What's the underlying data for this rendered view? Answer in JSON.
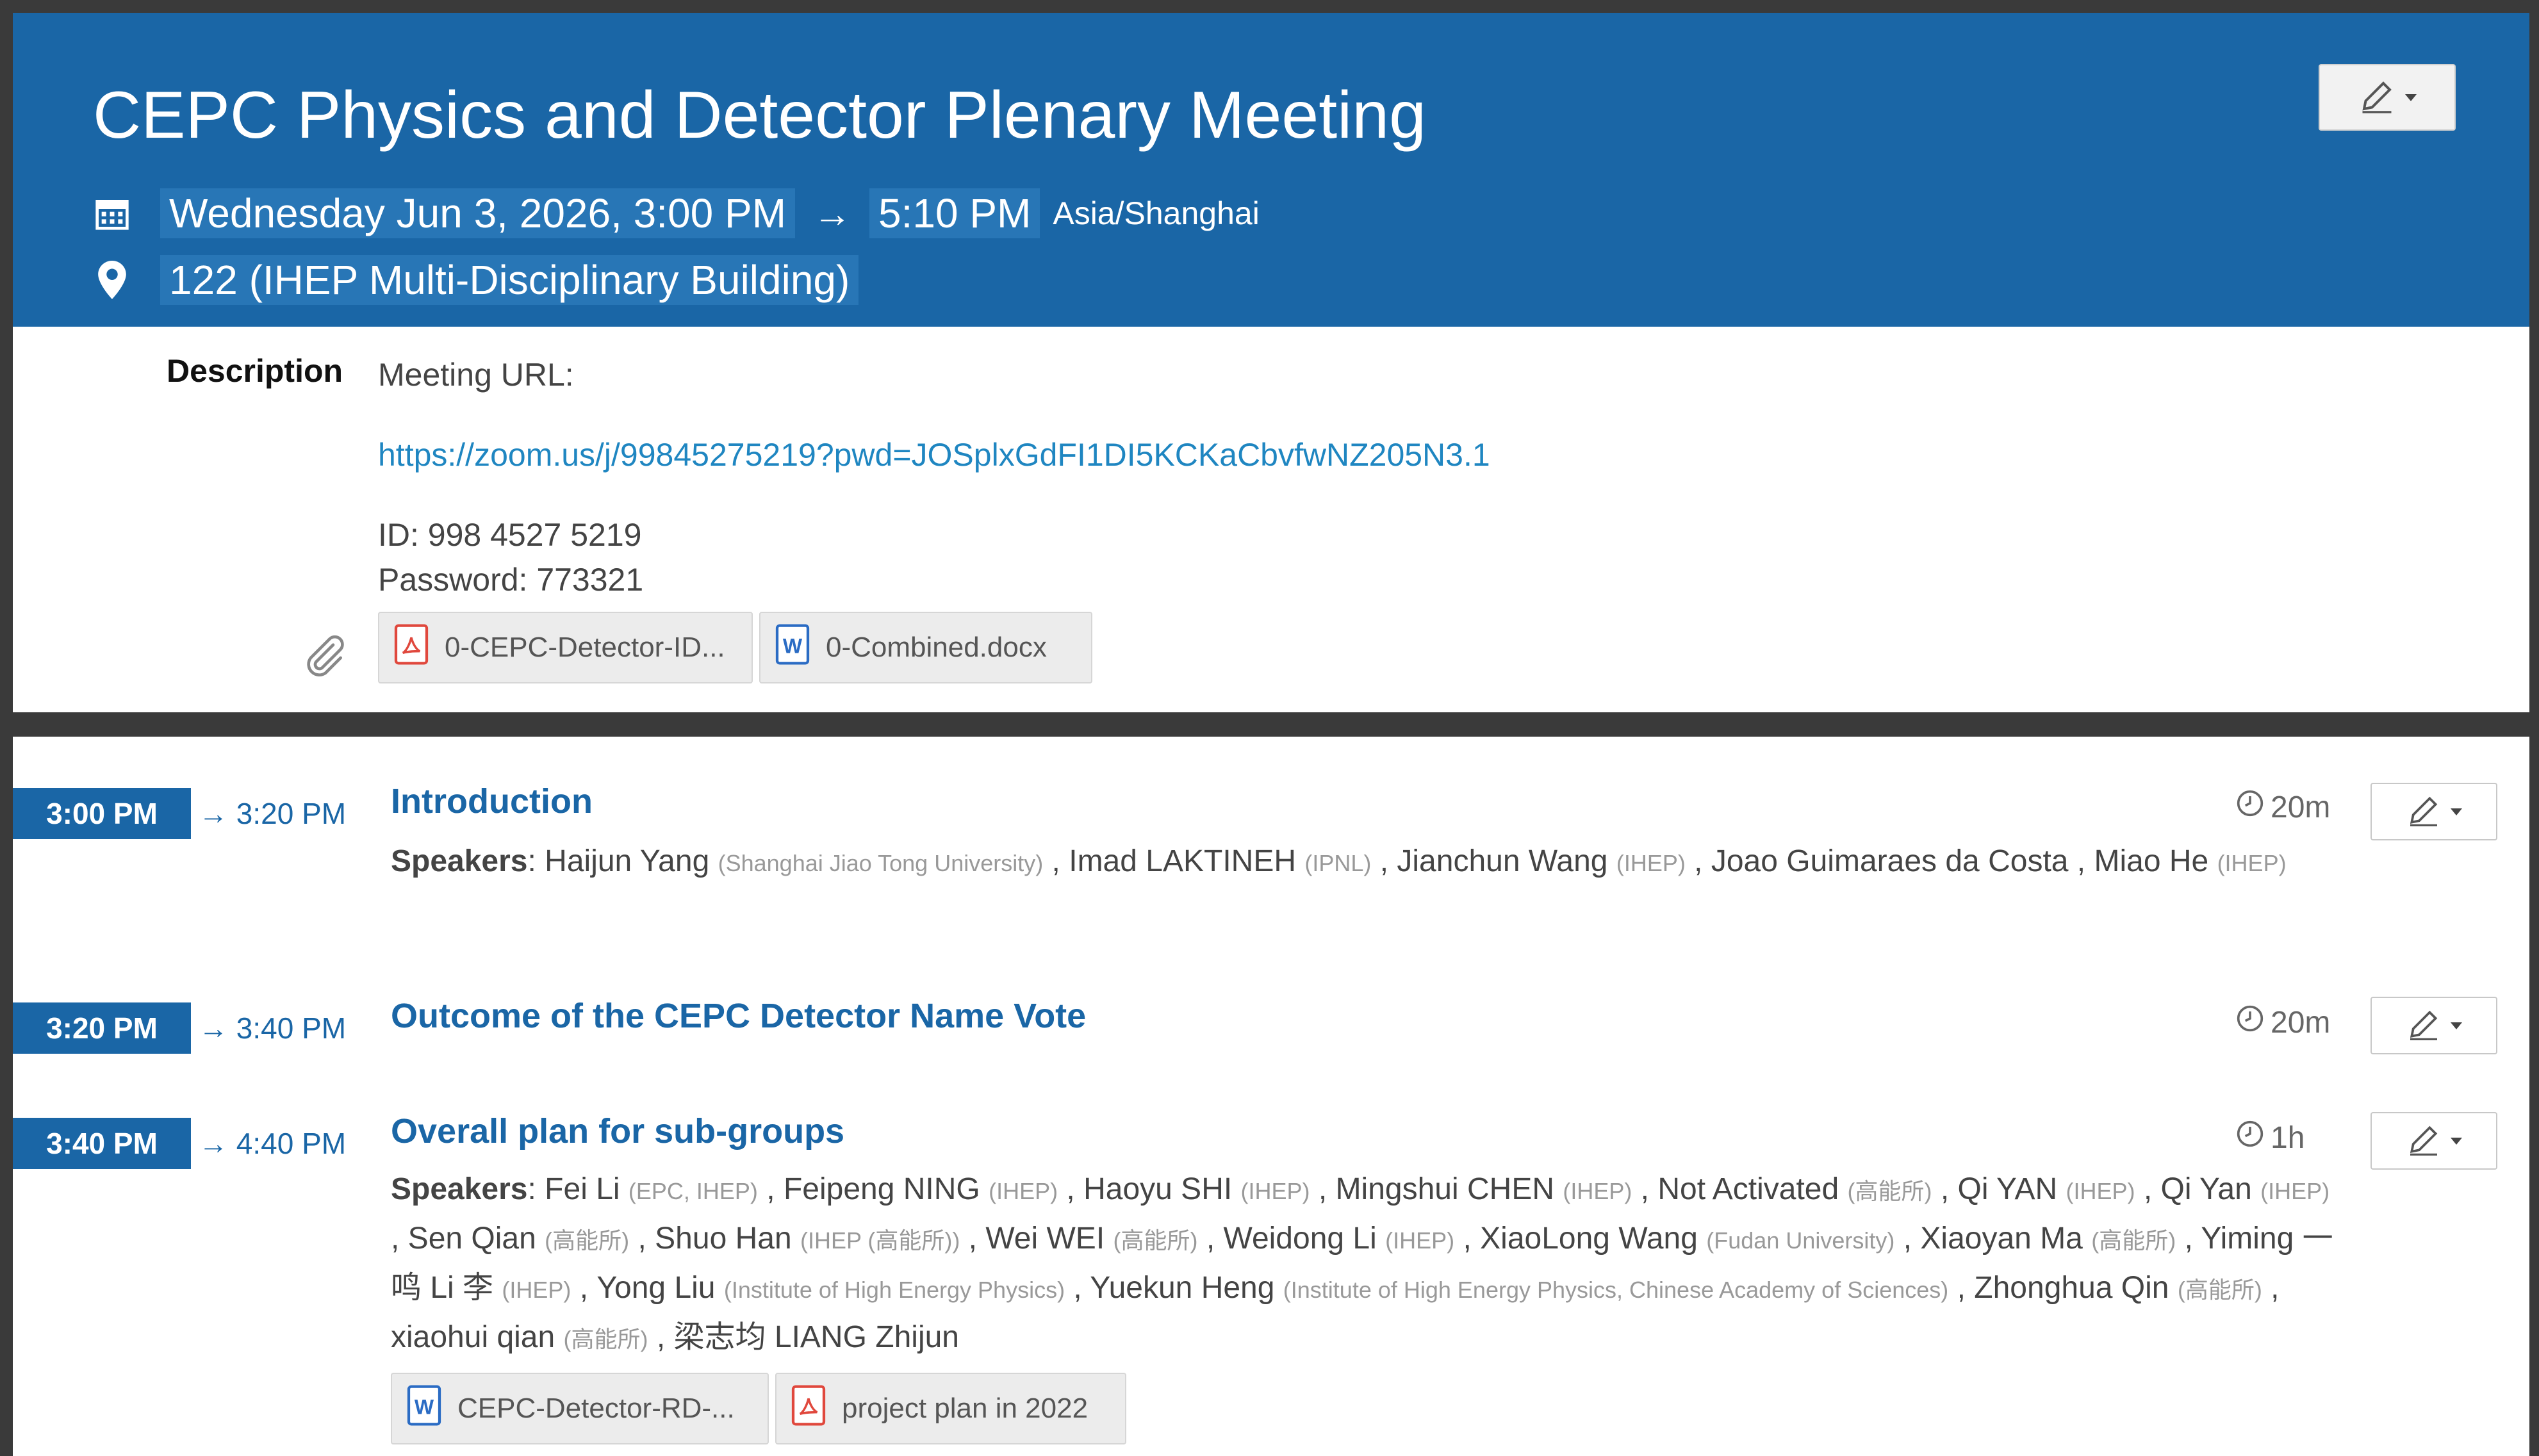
{
  "header": {
    "title": "CEPC Physics and Detector Plenary Meeting",
    "start": "Wednesday Jun 3, 2026, 3:00 PM",
    "arrow": "→",
    "end": "5:10 PM",
    "timezone": "Asia/Shanghai",
    "location": "122 (IHEP Multi-Disciplinary Building)",
    "icons": [
      "calendar-icon",
      "location-pin-icon",
      "pencil-edit-icon"
    ]
  },
  "description": {
    "label": "Description",
    "lines": [
      "Meeting URL:",
      "https://zoom.us/j/99845275219?pwd=JOSplxGdFI1DI5KCKaCbvfwNZ205N3.1",
      "ID: 998 4527 5219",
      "Password: 773321"
    ],
    "attachments": [
      {
        "name": "0-CEPC-Detector-ID...",
        "icon": "pdf-icon"
      },
      {
        "name": "0-Combined.docx",
        "icon": "word-doc-icon"
      }
    ]
  },
  "timetable": {
    "speakers_label": "Speakers",
    "entries": [
      {
        "start": "3:00 PM",
        "end": "→ 3:20 PM",
        "title": "Introduction",
        "duration": "20m"
      },
      {
        "start": "3:20 PM",
        "end": "→ 3:40 PM",
        "title": "Outcome of the CEPC Detector Name Vote",
        "duration": "20m"
      },
      {
        "start": "3:40 PM",
        "end": "→ 4:40 PM",
        "title": "Overall plan for sub-groups",
        "duration": "1h",
        "attachments": [
          {
            "name": "CEPC-Detector-RD-...",
            "icon": "word-doc-icon"
          },
          {
            "name": "project plan in 2022",
            "icon": "pdf-icon"
          }
        ]
      }
    ],
    "speakers_1": [
      {
        "name": "Haijun Yang",
        "aff": "(Shanghai Jiao Tong University)"
      },
      {
        "name": "Imad LAKTINEH",
        "aff": "(IPNL)"
      },
      {
        "name": "Jianchun Wang",
        "aff": "(IHEP)"
      },
      {
        "name": "Joao Guimaraes da Costa",
        "aff": ""
      },
      {
        "name": "Miao He",
        "aff": "(IHEP)"
      }
    ],
    "speakers_3": [
      {
        "name": "Fei Li",
        "aff": "(EPC, IHEP)"
      },
      {
        "name": "Feipeng NING",
        "aff": "(IHEP)"
      },
      {
        "name": "Haoyu SHI",
        "aff": "(IHEP)"
      },
      {
        "name": "Mingshui CHEN",
        "aff": "(IHEP)"
      },
      {
        "name": "Not Activated",
        "aff": "(高能所)"
      },
      {
        "name": "Qi YAN",
        "aff": "(IHEP)"
      },
      {
        "name": "Qi Yan",
        "aff": "(IHEP)"
      },
      {
        "name": "Sen Qian",
        "aff": "(高能所)"
      },
      {
        "name": "Shuo Han",
        "aff": "(IHEP (高能所))"
      },
      {
        "name": "Wei WEI",
        "aff": "(高能所)"
      },
      {
        "name": "Weidong Li",
        "aff": "(IHEP)"
      },
      {
        "name": "XiaoLong Wang",
        "aff": "(Fudan University)"
      },
      {
        "name": "Xiaoyan Ma",
        "aff": "(高能所)"
      },
      {
        "name": "Yiming 一鸣 Li 李",
        "aff": "(IHEP)"
      },
      {
        "name": "Yong Liu",
        "aff": "(Institute of High Energy Physics)"
      },
      {
        "name": "Yuekun Heng",
        "aff": "(Institute of High Energy Physics, Chinese Academy of Sciences)"
      },
      {
        "name": "Zhonghua Qin",
        "aff": "(高能所)"
      },
      {
        "name": "xiaohui qian",
        "aff": "(高能所)"
      },
      {
        "name": "梁志均 LIANG Zhijun",
        "aff": ""
      }
    ]
  },
  "colors": {
    "header_bg": "#1a66a6",
    "link": "#1f86c1",
    "badge_bg": "#1a66a6"
  }
}
